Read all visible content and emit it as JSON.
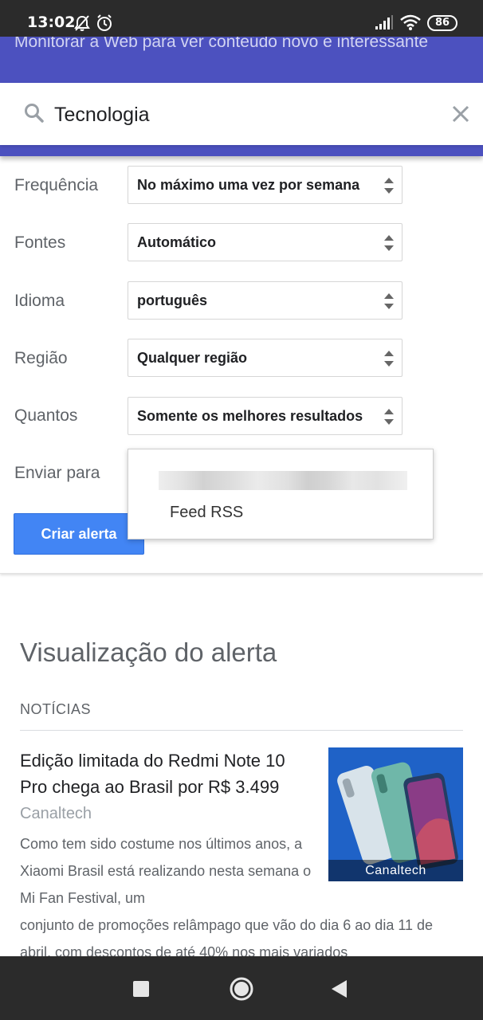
{
  "status_bar": {
    "time": "13:02",
    "battery": "86"
  },
  "header": {
    "subtitle": "Monitorar a Web para ver conteúdo novo e interessante"
  },
  "search": {
    "query": "Tecnologia"
  },
  "options": [
    {
      "label": "Frequência",
      "value": "No máximo uma vez por semana"
    },
    {
      "label": "Fontes",
      "value": "Automático"
    },
    {
      "label": "Idioma",
      "value": "português"
    },
    {
      "label": "Região",
      "value": "Qualquer região"
    },
    {
      "label": "Quantos",
      "value": "Somente os melhores resultados"
    }
  ],
  "send_to": {
    "label": "Enviar para",
    "dropdown_items": [
      "Feed RSS"
    ]
  },
  "create_button": "Criar alerta",
  "preview": {
    "title": "Visualização do alerta",
    "section": "NOTÍCIAS",
    "article": {
      "title": "Edição limitada do Redmi Note 10 Pro chega ao Brasil por R$ 3.499",
      "source": "Canaltech",
      "body_narrow": "Como tem sido costume nos últimos anos, a Xiaomi Brasil está realizando nesta semana o Mi Fan Festival, um",
      "body_wide": "conjunto de promoções relâmpago que vão do dia 6 ao dia 11 de abril, com descontos de até 40% nos mais variados",
      "thumbnail_caption": "Canaltech"
    }
  },
  "colors": {
    "header": "#4c51bf",
    "button": "#4285f4"
  }
}
